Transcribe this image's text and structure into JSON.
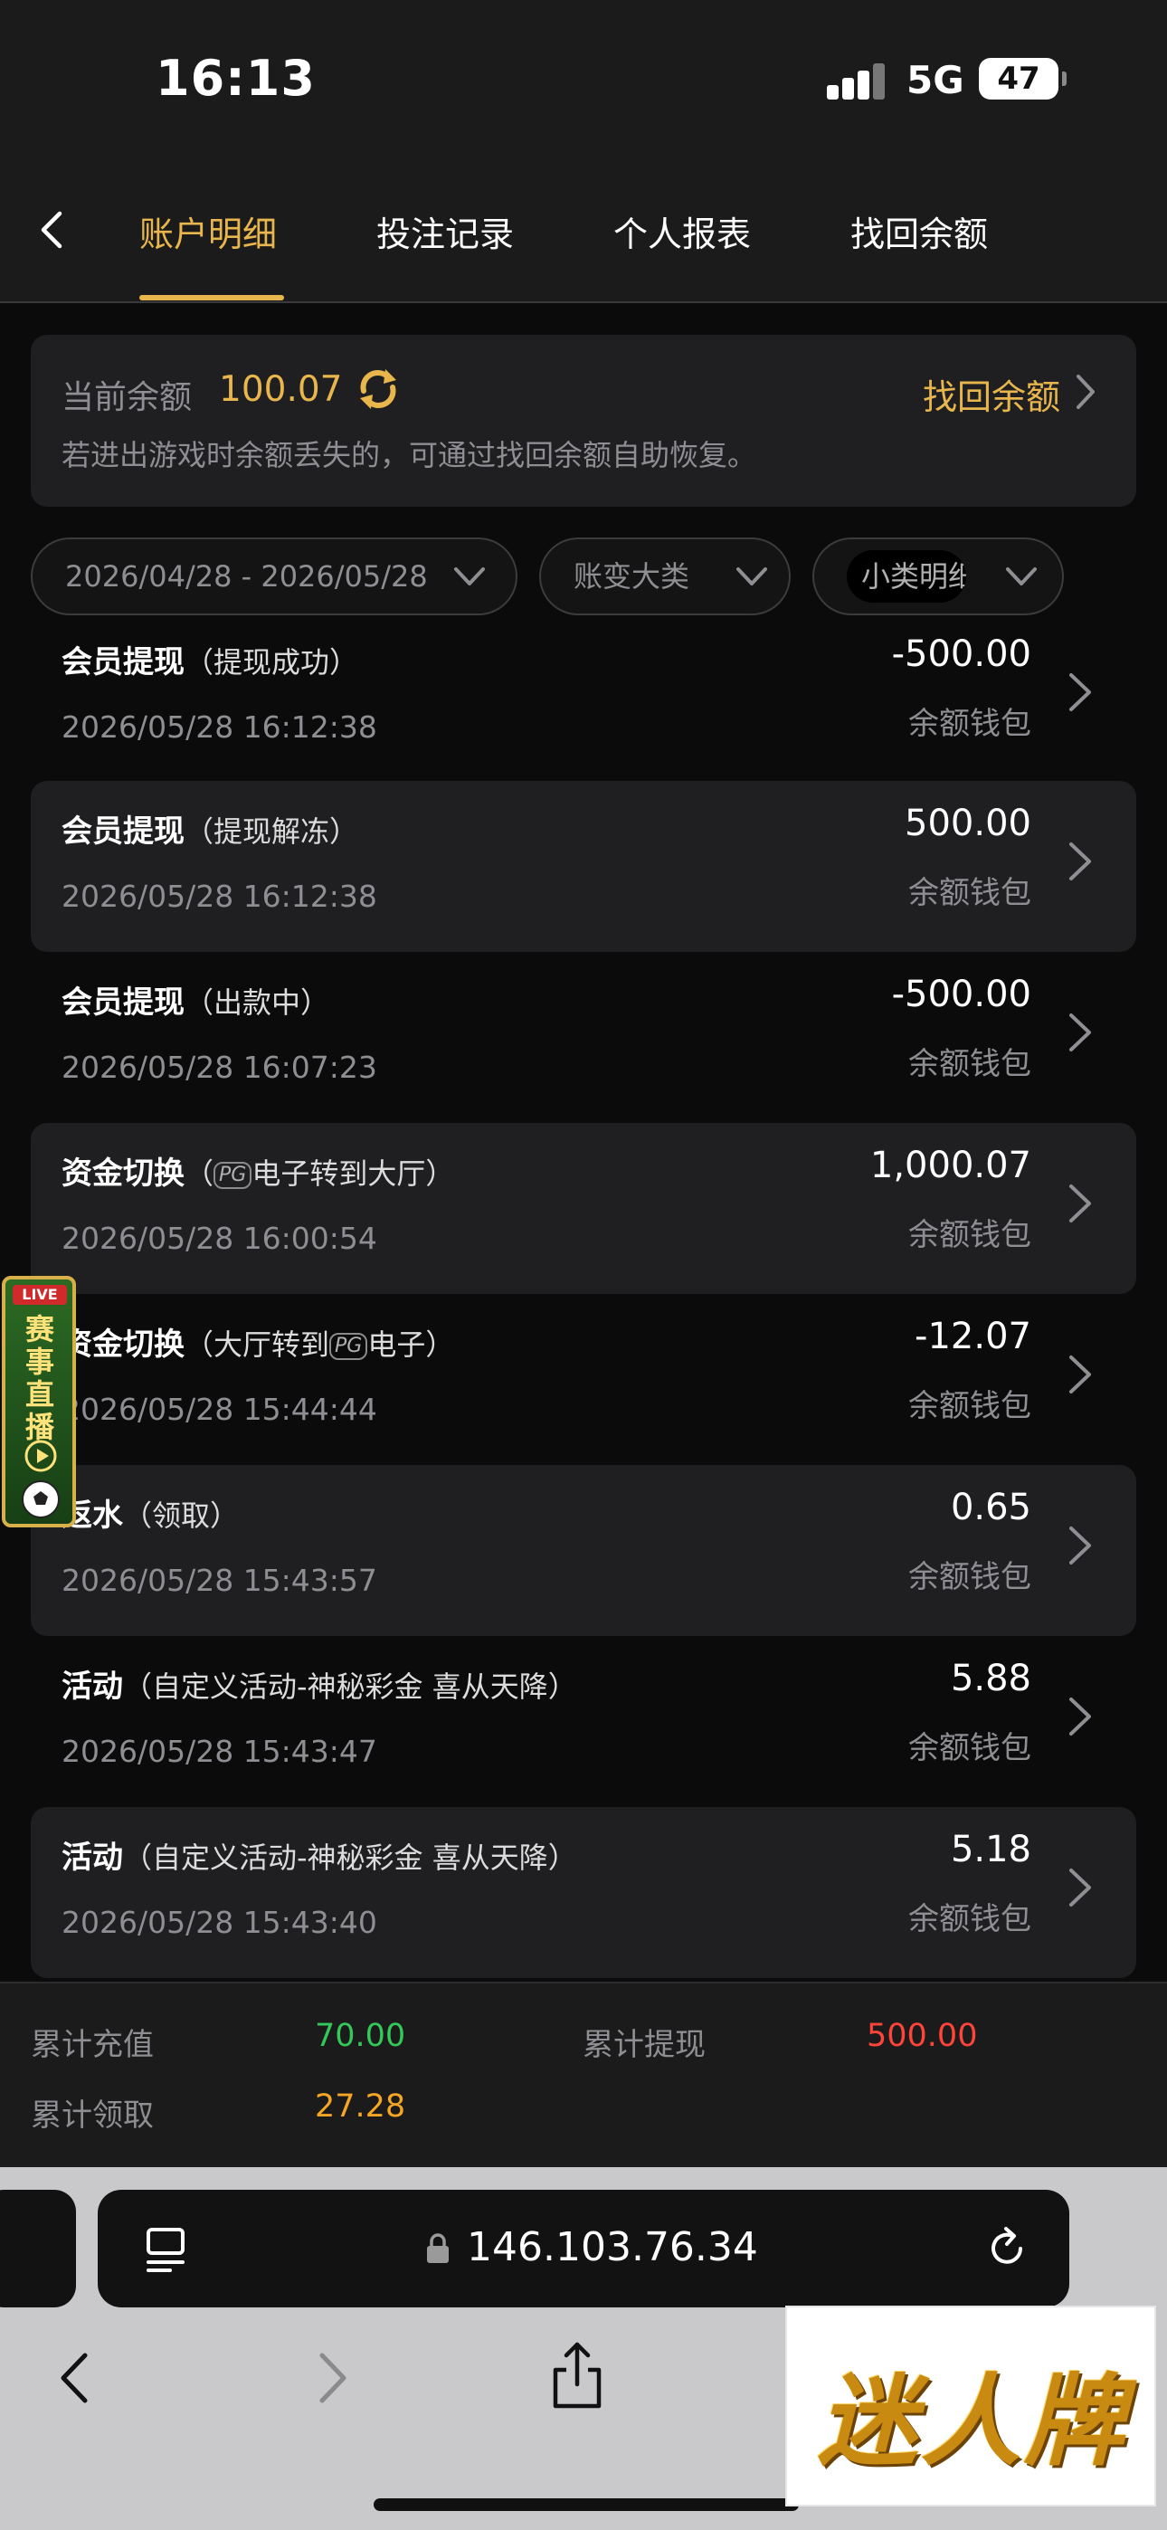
{
  "status_bar": {
    "time": "16:13",
    "network": "5G",
    "battery": "47"
  },
  "tabs": [
    {
      "label": "账户明细",
      "active": true
    },
    {
      "label": "投注记录",
      "active": false
    },
    {
      "label": "个人报表",
      "active": false
    },
    {
      "label": "找回余额",
      "active": false
    }
  ],
  "balance": {
    "label": "当前余额",
    "value": "100.07",
    "recover_label": "找回余额",
    "tip": "若进出游戏时余额丢失的，可通过找回余额自助恢复。"
  },
  "filters": {
    "date_range": "2026/04/28 - 2026/05/28",
    "category": "账变大类",
    "subcategory": "小类明细"
  },
  "transactions": [
    {
      "title": "会员提现",
      "sub_pre": "（提现成功）",
      "pg": "",
      "sub_post": "",
      "time": "2026/05/28 16:12:38",
      "amount": "-500.00",
      "wallet": "余额钱包"
    },
    {
      "title": "会员提现",
      "sub_pre": "（提现解冻）",
      "pg": "",
      "sub_post": "",
      "time": "2026/05/28 16:12:38",
      "amount": "500.00",
      "wallet": "余额钱包"
    },
    {
      "title": "会员提现",
      "sub_pre": "（出款中）",
      "pg": "",
      "sub_post": "",
      "time": "2026/05/28 16:07:23",
      "amount": "-500.00",
      "wallet": "余额钱包"
    },
    {
      "title": "资金切换",
      "sub_pre": "（",
      "pg": "PG",
      "sub_post": "电子转到大厅）",
      "time": "2026/05/28 16:00:54",
      "amount": "1,000.07",
      "wallet": "余额钱包"
    },
    {
      "title": "资金切换",
      "sub_pre": "（大厅转到",
      "pg": "PG",
      "sub_post": "电子）",
      "time": "2026/05/28 15:44:44",
      "amount": "-12.07",
      "wallet": "余额钱包"
    },
    {
      "title": "返水",
      "sub_pre": "（领取）",
      "pg": "",
      "sub_post": "",
      "time": "2026/05/28 15:43:57",
      "amount": "0.65",
      "wallet": "余额钱包"
    },
    {
      "title": "活动",
      "sub_pre": "（自定义活动-神秘彩金 喜从天降）",
      "pg": "",
      "sub_post": "",
      "time": "2026/05/28 15:43:47",
      "amount": "5.88",
      "wallet": "余额钱包"
    },
    {
      "title": "活动",
      "sub_pre": "（自定义活动-神秘彩金 喜从天降）",
      "pg": "",
      "sub_post": "",
      "time": "2026/05/28 15:43:40",
      "amount": "5.18",
      "wallet": "余额钱包"
    }
  ],
  "live_badge": {
    "tag": "LIVE",
    "chars": [
      "赛",
      "事",
      "直",
      "播"
    ]
  },
  "summary": {
    "deposit_label": "累计充值",
    "deposit_value": "70.00",
    "withdraw_label": "累计提现",
    "withdraw_value": "500.00",
    "claim_label": "累计领取",
    "claim_value": "27.28"
  },
  "colors": {
    "accent": "#e8b64c",
    "deposit": "#34c759",
    "withdraw": "#ff453a",
    "claim": "#f5a623"
  },
  "browser": {
    "url": "146.103.76.34"
  },
  "watermark": {
    "text": "迷人牌"
  }
}
